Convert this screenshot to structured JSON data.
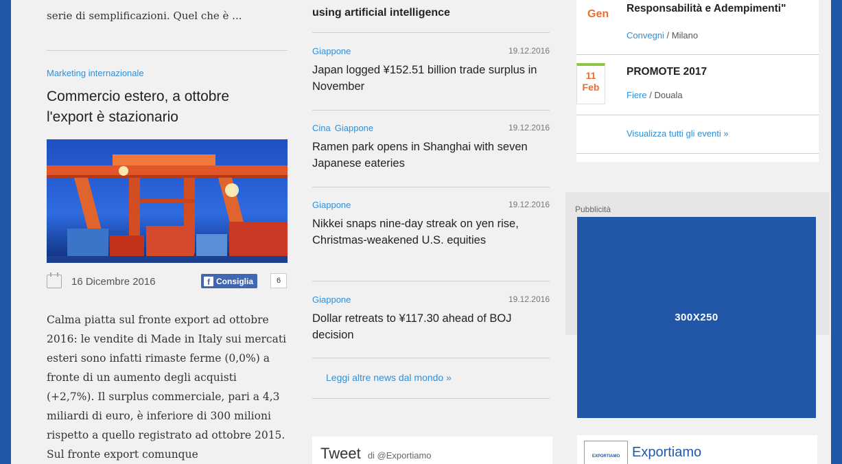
{
  "left": {
    "excerpt_top": "serie di semplificazioni. Quel che è ...",
    "category": "Marketing internazionale",
    "title": "Commercio estero, a ottobre l'export è stazionario",
    "date": "16 Dicembre 2016",
    "fb_label": "Consiglia",
    "fb_count": "6",
    "body": "Calma piatta sul fronte export ad ottobre 2016: le vendite di Made in Italy sui mercati esteri sono infatti rimaste ferme (0,0%) a fronte di un aumento degli acquisti (+2,7%). Il surplus commerciale, pari a 4,3 miliardi di euro, è inferiore di 300 milioni rispetto a quello registrato ad ottobre 2015. Sul fronte export comunque"
  },
  "middle": {
    "top_title": "using artificial intelligence",
    "news": [
      {
        "cats": [
          "Giappone"
        ],
        "date": "19.12.2016",
        "title": "Japan logged ¥152.51 billion trade surplus in November"
      },
      {
        "cats": [
          "Cina",
          "Giappone"
        ],
        "date": "19.12.2016",
        "title": "Ramen park opens in Shanghai with seven Japanese eateries"
      },
      {
        "cats": [
          "Giappone"
        ],
        "date": "19.12.2016",
        "title": "Nikkei snaps nine-day streak on yen rise, Christmas-weakened U.S. equities"
      },
      {
        "cats": [
          "Giappone"
        ],
        "date": "19.12.2016",
        "title": "Dollar retreats to ¥117.30 ahead of BOJ decision"
      }
    ],
    "more_link": "Leggi altre news dal mondo »",
    "tweet_title": "Tweet",
    "tweet_by": "di @Exportiamo"
  },
  "right": {
    "event1": {
      "month": "Gen",
      "title": "Responsabilità e Adempimenti\"",
      "type": "Convegni",
      "location": " / Milano"
    },
    "event2": {
      "day": "11",
      "month": "Feb",
      "title": "PROMOTE 2017",
      "type": "Fiere",
      "location": " / Douala"
    },
    "all_events": "Visualizza tutti gli eventi »",
    "ad_label": "Pubblicità",
    "ad_text": "300X250",
    "exp_name": "Exportiamo",
    "exp_logo_text": "EXPORTIAMO"
  },
  "colors": {
    "brand": "#2257a8",
    "accent": "#2f8fd8",
    "event_orange": "#f26a2a",
    "event_green": "#8dc63f"
  }
}
